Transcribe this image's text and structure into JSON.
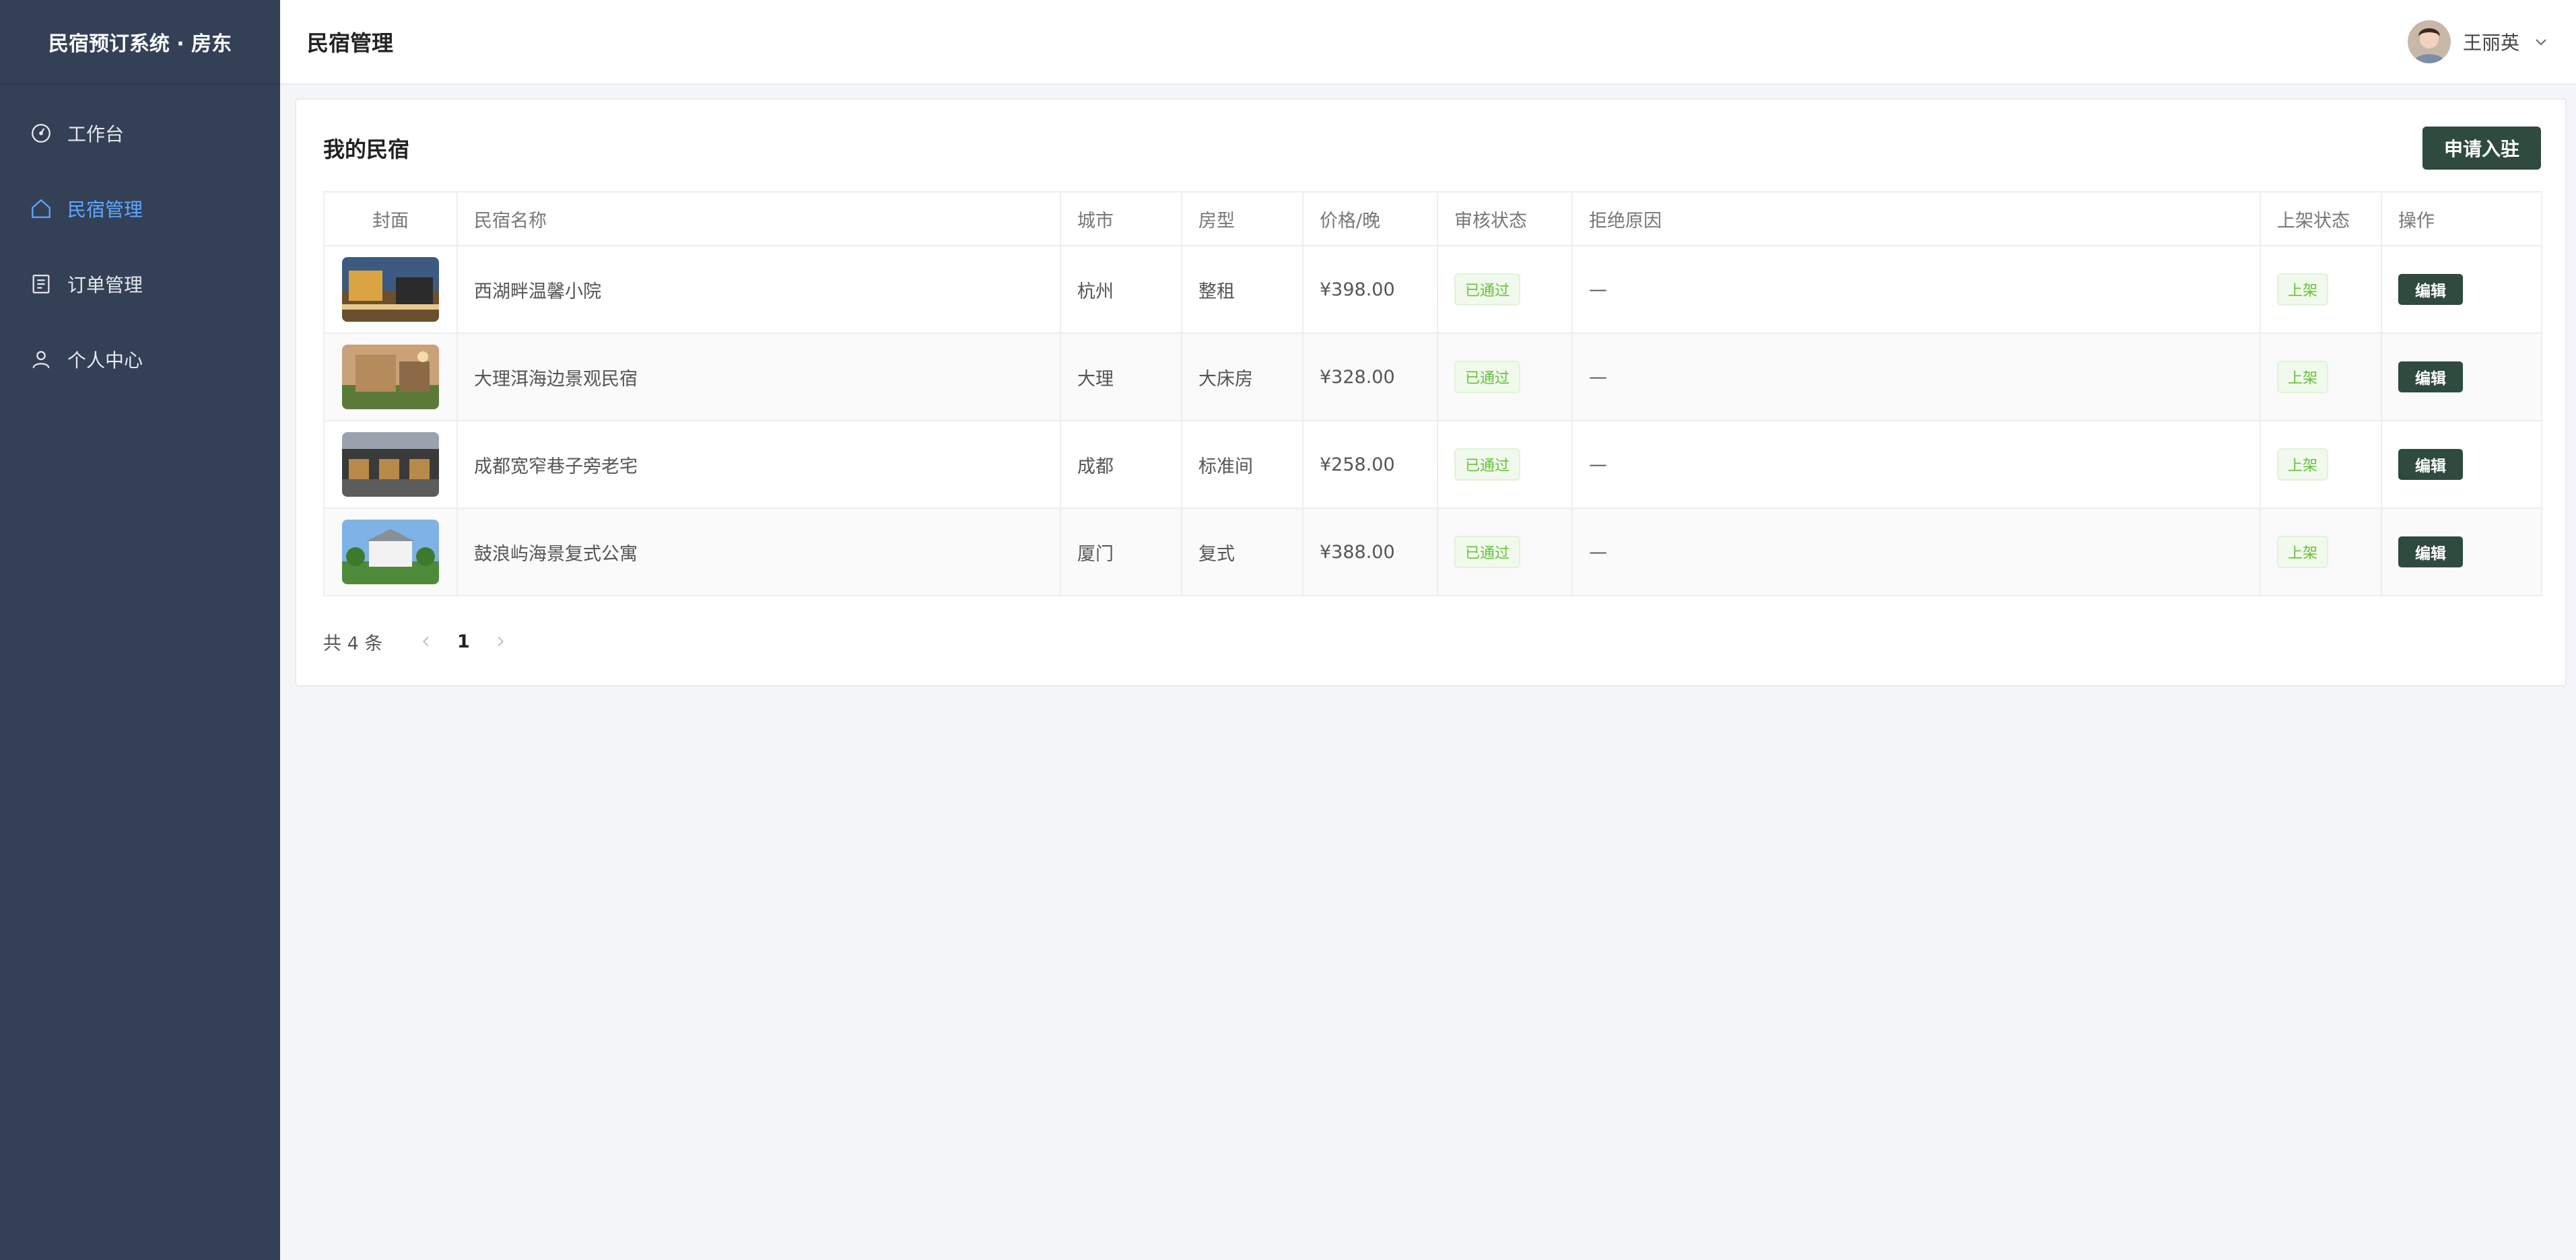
{
  "sidebar": {
    "brand": "民宿预订系统 · 房东",
    "items": [
      {
        "label": "工作台",
        "icon": "dashboard-icon"
      },
      {
        "label": "民宿管理",
        "icon": "home-icon",
        "active": true
      },
      {
        "label": "订单管理",
        "icon": "document-icon"
      },
      {
        "label": "个人中心",
        "icon": "user-icon"
      }
    ]
  },
  "header": {
    "title": "民宿管理",
    "user_name": "王丽英"
  },
  "card": {
    "title": "我的民宿",
    "apply_button": "申请入驻"
  },
  "table": {
    "columns": [
      "封面",
      "民宿名称",
      "城市",
      "房型",
      "价格/晚",
      "审核状态",
      "拒绝原因",
      "上架状态",
      "操作"
    ],
    "rows": [
      {
        "name": "西湖畔温馨小院",
        "city": "杭州",
        "room_type": "整租",
        "price": "¥398.00",
        "audit": "已通过",
        "reason": "—",
        "listing": "上架",
        "action": "编辑"
      },
      {
        "name": "大理洱海边景观民宿",
        "city": "大理",
        "room_type": "大床房",
        "price": "¥328.00",
        "audit": "已通过",
        "reason": "—",
        "listing": "上架",
        "action": "编辑"
      },
      {
        "name": "成都宽窄巷子旁老宅",
        "city": "成都",
        "room_type": "标准间",
        "price": "¥258.00",
        "audit": "已通过",
        "reason": "—",
        "listing": "上架",
        "action": "编辑"
      },
      {
        "name": "鼓浪屿海景复式公寓",
        "city": "厦门",
        "room_type": "复式",
        "price": "¥388.00",
        "audit": "已通过",
        "reason": "—",
        "listing": "上架",
        "action": "编辑"
      }
    ]
  },
  "pagination": {
    "total": "共 4 条",
    "current": "1"
  },
  "colors": {
    "sidebar_bg": "#334056",
    "active_menu": "#5fa8ff",
    "primary_button": "#2f4a3e",
    "success_tag": "#67c23a"
  }
}
